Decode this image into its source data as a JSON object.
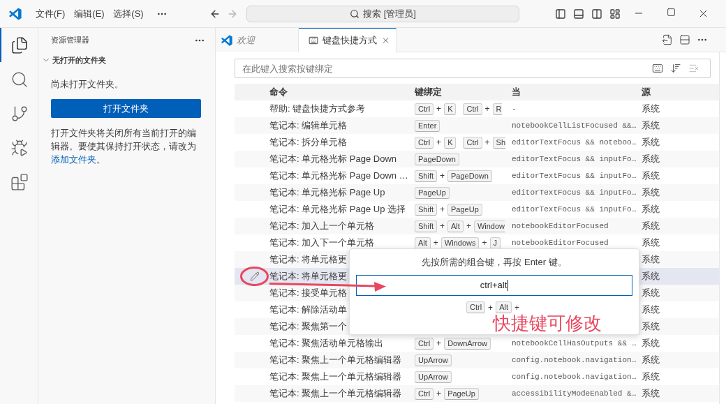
{
  "title_bar": {
    "menus": [
      "文件(F)",
      "编辑(E)",
      "选择(S)"
    ],
    "command_center": "搜索 [管理员]"
  },
  "activity_bar": [
    {
      "selected": true
    },
    {
      "selected": false
    },
    {
      "selected": false
    },
    {
      "selected": false
    },
    {
      "selected": false
    }
  ],
  "sidebar": {
    "title": "资源管理器",
    "section": {
      "title": "无打开的文件夹",
      "expanded": true
    },
    "message": "尚未打开文件夹。",
    "button": "打开文件夹",
    "note": "打开文件夹将关闭所有当前打开的编辑器。要使其保持打开状态，请改为",
    "link": "添加文件夹",
    "note_end": "。"
  },
  "tabs": [
    {
      "label": "欢迎",
      "kind": "welcome",
      "preview": true,
      "selected": false
    },
    {
      "label": "键盘快捷方式",
      "kind": "keyboard",
      "preview": false,
      "selected": true
    }
  ],
  "search": {
    "placeholder": "在此键入搜索按键绑定"
  },
  "table": {
    "columns": [
      "命令",
      "键绑定",
      "当",
      "源"
    ],
    "rows": [
      {
        "command": "帮助: 键盘快捷方式参考",
        "chords": [
          [
            {
              "kind": "key",
              "label": "Ctrl"
            },
            {
              "kind": "plus",
              "label": "+"
            },
            {
              "kind": "key",
              "label": "K"
            }
          ],
          [
            {
              "kind": "key",
              "label": "Ctrl"
            },
            {
              "kind": "plus",
              "label": "+"
            },
            {
              "kind": "partial",
              "label": "R"
            }
          ]
        ],
        "when": "-",
        "source": "系统",
        "selected": false
      },
      {
        "command": "笔记本: 编辑单元格",
        "chords": [
          [
            {
              "kind": "key",
              "label": "Enter"
            }
          ]
        ],
        "when": "notebookCellListFocused &&…",
        "source": "系统",
        "selected": false
      },
      {
        "command": "笔记本: 拆分单元格",
        "chords": [
          [
            {
              "kind": "key",
              "label": "Ctrl"
            },
            {
              "kind": "plus",
              "label": "+"
            },
            {
              "kind": "key",
              "label": "K"
            }
          ],
          [
            {
              "kind": "key",
              "label": "Ctrl"
            },
            {
              "kind": "plus",
              "label": "+"
            },
            {
              "kind": "partial",
              "label": "Sh"
            }
          ]
        ],
        "when": "editorTextFocus && noteboo…",
        "source": "系统",
        "selected": false
      },
      {
        "command": "笔记本: 单元格光标 Page Down",
        "chords": [
          [
            {
              "kind": "key",
              "label": "PageDown"
            }
          ]
        ],
        "when": "editorTextFocus && inputFo…",
        "source": "系统",
        "selected": false
      },
      {
        "command": "笔记本: 单元格光标 Page Down …",
        "chords": [
          [
            {
              "kind": "key",
              "label": "Shift"
            },
            {
              "kind": "plus",
              "label": "+"
            },
            {
              "kind": "key",
              "label": "PageDown"
            }
          ]
        ],
        "when": "editorTextFocus && inputFo…",
        "source": "系统",
        "selected": false
      },
      {
        "command": "笔记本: 单元格光标 Page Up",
        "chords": [
          [
            {
              "kind": "key",
              "label": "PageUp"
            }
          ]
        ],
        "when": "editorTextFocus && inputFo…",
        "source": "系统",
        "selected": false
      },
      {
        "command": "笔记本: 单元格光标 Page Up 选择",
        "chords": [
          [
            {
              "kind": "key",
              "label": "Shift"
            },
            {
              "kind": "plus",
              "label": "+"
            },
            {
              "kind": "key",
              "label": "PageUp"
            }
          ]
        ],
        "when": "editorTextFocus && inputFo…",
        "source": "系统",
        "selected": false
      },
      {
        "command": "笔记本: 加入上一个单元格",
        "chords": [
          [
            {
              "kind": "key",
              "label": "Shift"
            },
            {
              "kind": "plus",
              "label": "+"
            },
            {
              "kind": "key",
              "label": "Alt"
            },
            {
              "kind": "plus",
              "label": "+"
            },
            {
              "kind": "partial",
              "label": "Window"
            }
          ]
        ],
        "when": "notebookEditorFocused",
        "source": "系统",
        "selected": false
      },
      {
        "command": "笔记本: 加入下一个单元格",
        "chords": [
          [
            {
              "kind": "key",
              "label": "Alt"
            },
            {
              "kind": "plus",
              "label": "+"
            },
            {
              "kind": "key",
              "label": "Windows"
            },
            {
              "kind": "plus",
              "label": "+"
            },
            {
              "kind": "key",
              "label": "J"
            }
          ]
        ],
        "when": "notebookEditorFocused",
        "source": "系统",
        "selected": false
      },
      {
        "command": "笔记本: 将单元格更",
        "source": "系统",
        "selected": false
      },
      {
        "command": "笔记本: 将单元格更",
        "source": "系统",
        "selected": true
      },
      {
        "command": "笔记本: 接受单元格",
        "source": "系统",
        "selected": false
      },
      {
        "command": "笔记本: 解除活动单",
        "source": "系统",
        "selected": false
      },
      {
        "command": "笔记本: 聚焦第一个",
        "source": "系统",
        "selected": false
      },
      {
        "command": "笔记本: 聚焦活动单元格输出",
        "chords": [
          [
            {
              "kind": "key",
              "label": "Ctrl"
            },
            {
              "kind": "plus",
              "label": "+"
            },
            {
              "kind": "key",
              "label": "DownArrow"
            }
          ]
        ],
        "when": "notebookCellHasOutputs && …",
        "source": "系统",
        "selected": false
      },
      {
        "command": "笔记本: 聚焦上一个单元格编辑器",
        "chords": [
          [
            {
              "kind": "key",
              "label": "UpArrow"
            }
          ]
        ],
        "when": "config.notebook.navigation…",
        "source": "系统",
        "selected": false
      },
      {
        "command": "笔记本: 聚焦上一个单元格编辑器",
        "chords": [
          [
            {
              "kind": "key",
              "label": "UpArrow"
            }
          ]
        ],
        "when": "config.notebook.navigation…",
        "source": "系统",
        "selected": false
      },
      {
        "command": "笔记本: 聚焦上一个单元格编辑器",
        "chords": [
          [
            {
              "kind": "key",
              "label": "Ctrl"
            },
            {
              "kind": "plus",
              "label": "+"
            },
            {
              "kind": "key",
              "label": "PageUp"
            }
          ]
        ],
        "when": "accessibilityModeEnabled &…",
        "source": "系统",
        "selected": false
      }
    ]
  },
  "dialog": {
    "prompt": "先按所需的组合键，再按 Enter 键。",
    "value": "ctrl+alt",
    "keys": [
      {
        "kind": "key",
        "label": "Ctrl"
      },
      {
        "kind": "plus",
        "label": "+"
      },
      {
        "kind": "key",
        "label": "Alt"
      },
      {
        "kind": "plus",
        "label": "+"
      }
    ]
  },
  "annotation": {
    "text": "快捷键可修改"
  }
}
